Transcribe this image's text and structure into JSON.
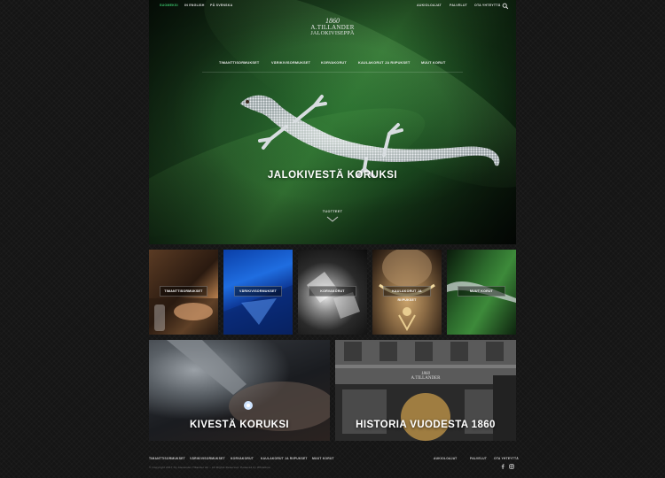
{
  "topnav": {
    "lang_fi": "SUOMEKSI",
    "lang_en": "IN ENGLISH",
    "lang_sv": "PÅ SVENSKA",
    "hours": "AUKIOLOAJAT",
    "services": "PALVELUT",
    "contact": "OTA YHTEYTTÄ"
  },
  "logo": {
    "year": "1860",
    "name": "A.TILLANDER",
    "subtitle": "JALOKIVISEPPÄ"
  },
  "catnav": {
    "items": [
      "TIMANTTISORMUKSET",
      "VÄRIKIVISORMUKSET",
      "KORVAKORUT",
      "KAULAKORUT JA RIIPUKSET",
      "MUUT KORUT"
    ]
  },
  "hero": {
    "title": "JALOKIVESTÄ KORUKSI",
    "products_label": "TUOTTEET"
  },
  "tiles": [
    "TIMANTTISORMUKSET",
    "VÄRIKIVISORMUKSET",
    "KORVAKORUT",
    "KAULAKORUT JA RIIPUKSET",
    "MUUT KORUT"
  ],
  "banners": {
    "left": "KIVESTÄ KORUKSI",
    "right": "HISTORIA VUODESTA 1860"
  },
  "storefront": {
    "sign_year": "1860",
    "sign_name": "A.TILLANDER"
  },
  "footer": {
    "links": [
      "TIMANTTISORMUKSET",
      "VÄRIKIVISORMUKSET",
      "KORVAKORUT",
      "KAULAKORUT JA RIIPUKSET",
      "MUUT KORUT"
    ],
    "right_links": [
      "AUKIOLOAJAT",
      "PALVELUT",
      "OTA YHTEYTTÄ"
    ],
    "copyright": "© Copyright 2017 Oy Alexander Tillander Ab – All Rights Reserved. Powered by Whitelime"
  },
  "icons": {
    "search": "search-icon",
    "chevron": "chevron-down-icon",
    "facebook": "facebook-icon",
    "instagram": "instagram-icon"
  },
  "colors": {
    "accent": "#3bc46b"
  }
}
